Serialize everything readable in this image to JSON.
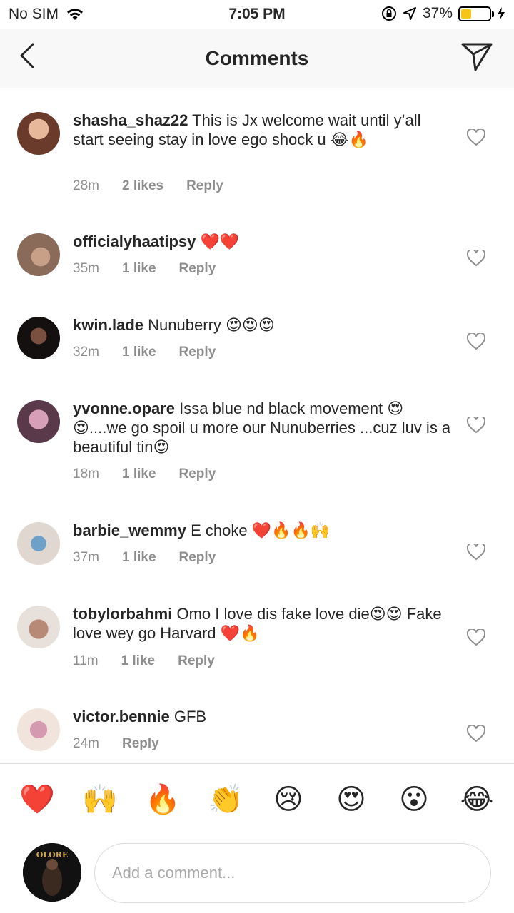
{
  "status_bar": {
    "carrier": "No SIM",
    "time": "7:05 PM",
    "battery": "37%",
    "battery_level": 0.37,
    "battery_color": "#f5c518"
  },
  "header": {
    "title": "Comments",
    "back_icon": "chevron-left-icon",
    "send_icon": "paper-plane-icon"
  },
  "comments": [
    {
      "username": "shasha_shaz22",
      "text": "This is Jx welcome wait until y’all start seeing stay in love ego shock u 😂🔥",
      "time": "28m",
      "likes": "2 likes",
      "reply": "Reply",
      "avatar_color": "#b07a5a"
    },
    {
      "username": "officialyhaatipsy",
      "text": "❤️❤️",
      "time": "35m",
      "likes": "1 like",
      "reply": "Reply",
      "avatar_color": "#8c6a55"
    },
    {
      "username": "kwin.lade",
      "text": "Nunuberry 😍😍😍",
      "time": "32m",
      "likes": "1 like",
      "reply": "Reply",
      "avatar_color": "#2a1f1a"
    },
    {
      "username": "yvonne.opare",
      "text": "Issa blue nd black movement 😍😍....we go spoil u more our Nunuberries ...cuz luv is a beautiful tin😍",
      "time": "18m",
      "likes": "1 like",
      "reply": "Reply",
      "avatar_color": "#c78aa8"
    },
    {
      "username": "barbie_wemmy",
      "text": "E choke ❤️🔥🔥🙌",
      "time": "37m",
      "likes": "1 like",
      "reply": "Reply",
      "avatar_color": "#6fa0c8"
    },
    {
      "username": "tobylorbahmi",
      "text": "Omo I love dis fake love die😍😍 Fake love wey go Harvard ❤️🔥",
      "time": "11m",
      "likes": "1 like",
      "reply": "Reply",
      "avatar_color": "#b68a76"
    },
    {
      "username": "victor.bennie",
      "text": "GFB",
      "time": "24m",
      "likes": "",
      "reply": "Reply",
      "avatar_color": "#d49ab0"
    }
  ],
  "reactions": [
    "❤️",
    "🙌",
    "🔥",
    "👏",
    "😢",
    "😍",
    "😮",
    "😂"
  ],
  "composer": {
    "placeholder": "Add a comment...",
    "avatar_text": "OLORE"
  }
}
